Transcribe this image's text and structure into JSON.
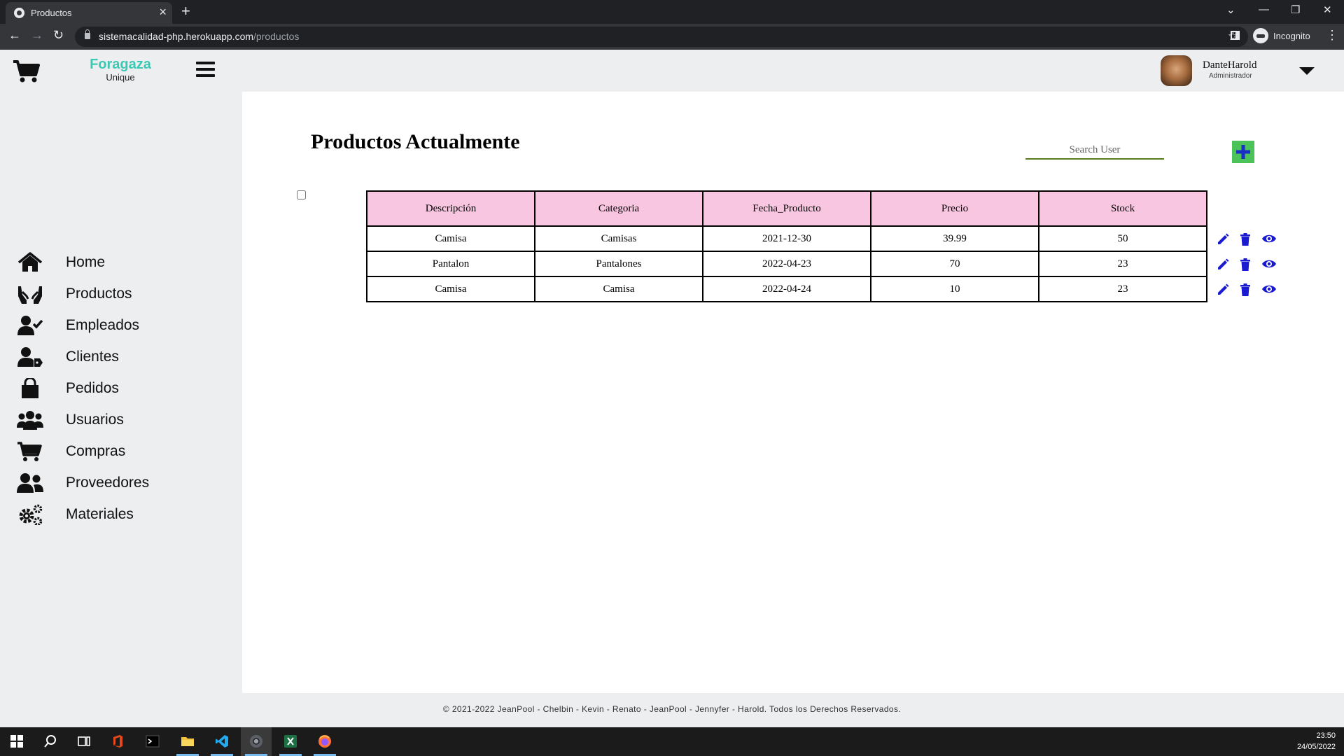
{
  "browser": {
    "tab_title": "Productos",
    "url_domain": "sistemacalidad-php.herokuapp.com",
    "url_path": "/productos",
    "incognito_label": "Incognito"
  },
  "header": {
    "brand_name": "Foragaza",
    "brand_sub": "Unique",
    "user_name": "DanteHarold",
    "user_role": "Administrador"
  },
  "sidebar": {
    "items": [
      {
        "label": "Home",
        "icon": "home-icon"
      },
      {
        "label": "Productos",
        "icon": "hands-holding-icon"
      },
      {
        "label": "Empleados",
        "icon": "user-check-icon"
      },
      {
        "label": "Clientes",
        "icon": "user-tag-icon"
      },
      {
        "label": "Pedidos",
        "icon": "shopping-bag-icon"
      },
      {
        "label": "Usuarios",
        "icon": "users-icon"
      },
      {
        "label": "Compras",
        "icon": "cart-icon"
      },
      {
        "label": "Proveedores",
        "icon": "user-friends-icon"
      },
      {
        "label": "Materiales",
        "icon": "cogs-icon"
      }
    ]
  },
  "main": {
    "title": "Productos Actualmente",
    "search_placeholder": "Search User",
    "accent_add": "#4cc35a",
    "table": {
      "headers": [
        "Descripción",
        "Categoria",
        "Fecha_Producto",
        "Precio",
        "Stock"
      ],
      "rows": [
        [
          "Camisa",
          "Camisas",
          "2021-12-30",
          "39.99",
          "50"
        ],
        [
          "Pantalon",
          "Pantalones",
          "2022-04-23",
          "70",
          "23"
        ],
        [
          "Camisa",
          "Camisa",
          "2022-04-24",
          "10",
          "23"
        ]
      ],
      "header_bg": "#f9c6e1"
    }
  },
  "footer": {
    "text": "© 2021-2022 JeanPool - Chelbin - Kevin - Renato - JeanPool - Jennyfer - Harold. Todos los Derechos Reservados."
  },
  "taskbar": {
    "time": "23:50",
    "date": "24/05/2022"
  }
}
